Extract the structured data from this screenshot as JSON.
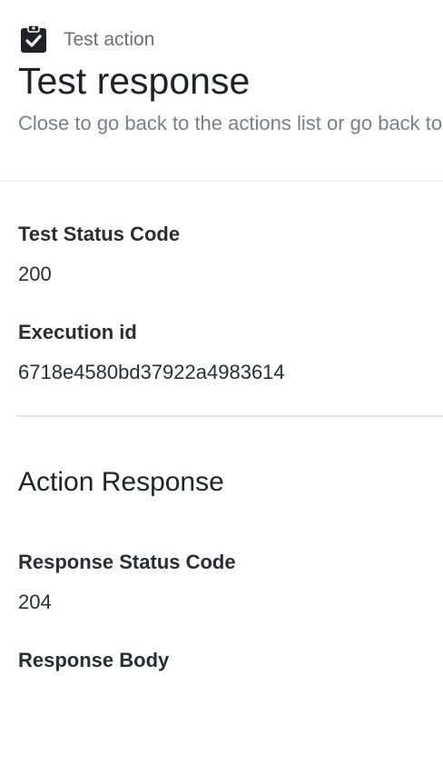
{
  "header": {
    "eyebrow_icon": "clipboard-check-icon",
    "eyebrow_label": "Test action",
    "title": "Test response",
    "subtitle": "Close to go back to the actions list or go back to edit the action"
  },
  "test_details": {
    "status_code_label": "Test Status Code",
    "status_code_value": "200",
    "execution_id_label": "Execution id",
    "execution_id_value": "6718e4580bd37922a4983614"
  },
  "action_response": {
    "section_title": "Action Response",
    "status_code_label": "Response Status Code",
    "status_code_value": "204",
    "body_label": "Response Body",
    "body_value": ""
  },
  "colors": {
    "text_primary": "#1f2328",
    "text_secondary": "#7b8088",
    "divider": "#e2e4e8",
    "icon": "#1f2328"
  }
}
